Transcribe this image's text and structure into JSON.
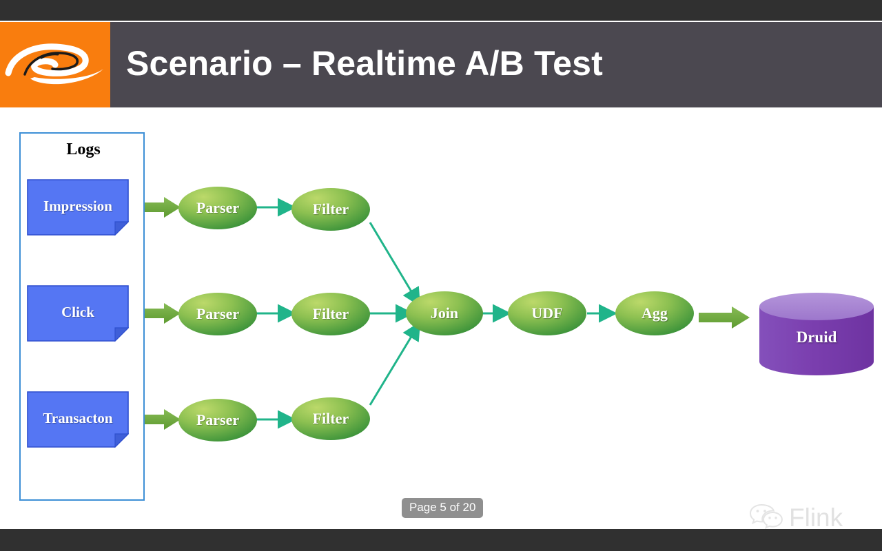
{
  "viewer": {
    "page_indicator": "Page 5 of 20",
    "letterbox_color": "#303030"
  },
  "header": {
    "title": "Scenario – Realtime A/B Test",
    "band_color": "#4b4850",
    "logo": {
      "name": "alibaba-logo",
      "background": "#f97d0e",
      "mark_color": "#ffffff"
    }
  },
  "diagram": {
    "logs_panel": {
      "label": "Logs",
      "border_color": "#3d8fd6",
      "sources": [
        {
          "label": "Impression",
          "fill": "#5576f3",
          "stroke": "#2f4fce"
        },
        {
          "label": "Click",
          "fill": "#5576f3",
          "stroke": "#2f4fce"
        },
        {
          "label": "Transacton",
          "fill": "#5576f3",
          "stroke": "#2f4fce"
        }
      ]
    },
    "node_fill_light": "#a9cc5a",
    "node_fill_dark": "#3f9a3a",
    "arrow_color": "#20b48a",
    "block_arrow_color": "#6aa739",
    "pipelines": [
      {
        "stages": [
          "Parser",
          "Filter"
        ]
      },
      {
        "stages": [
          "Parser",
          "Filter"
        ]
      },
      {
        "stages": [
          "Parser",
          "Filter"
        ]
      }
    ],
    "merge_stages": [
      {
        "label": "Join"
      },
      {
        "label": "UDF"
      },
      {
        "label": "Agg"
      }
    ],
    "sink": {
      "label": "Druid",
      "body_color": "#7b3faf",
      "top_color": "#a983d2"
    }
  },
  "watermark": {
    "text": "Flink",
    "icon": "wechat-icon",
    "color": "#c9c9c9"
  }
}
